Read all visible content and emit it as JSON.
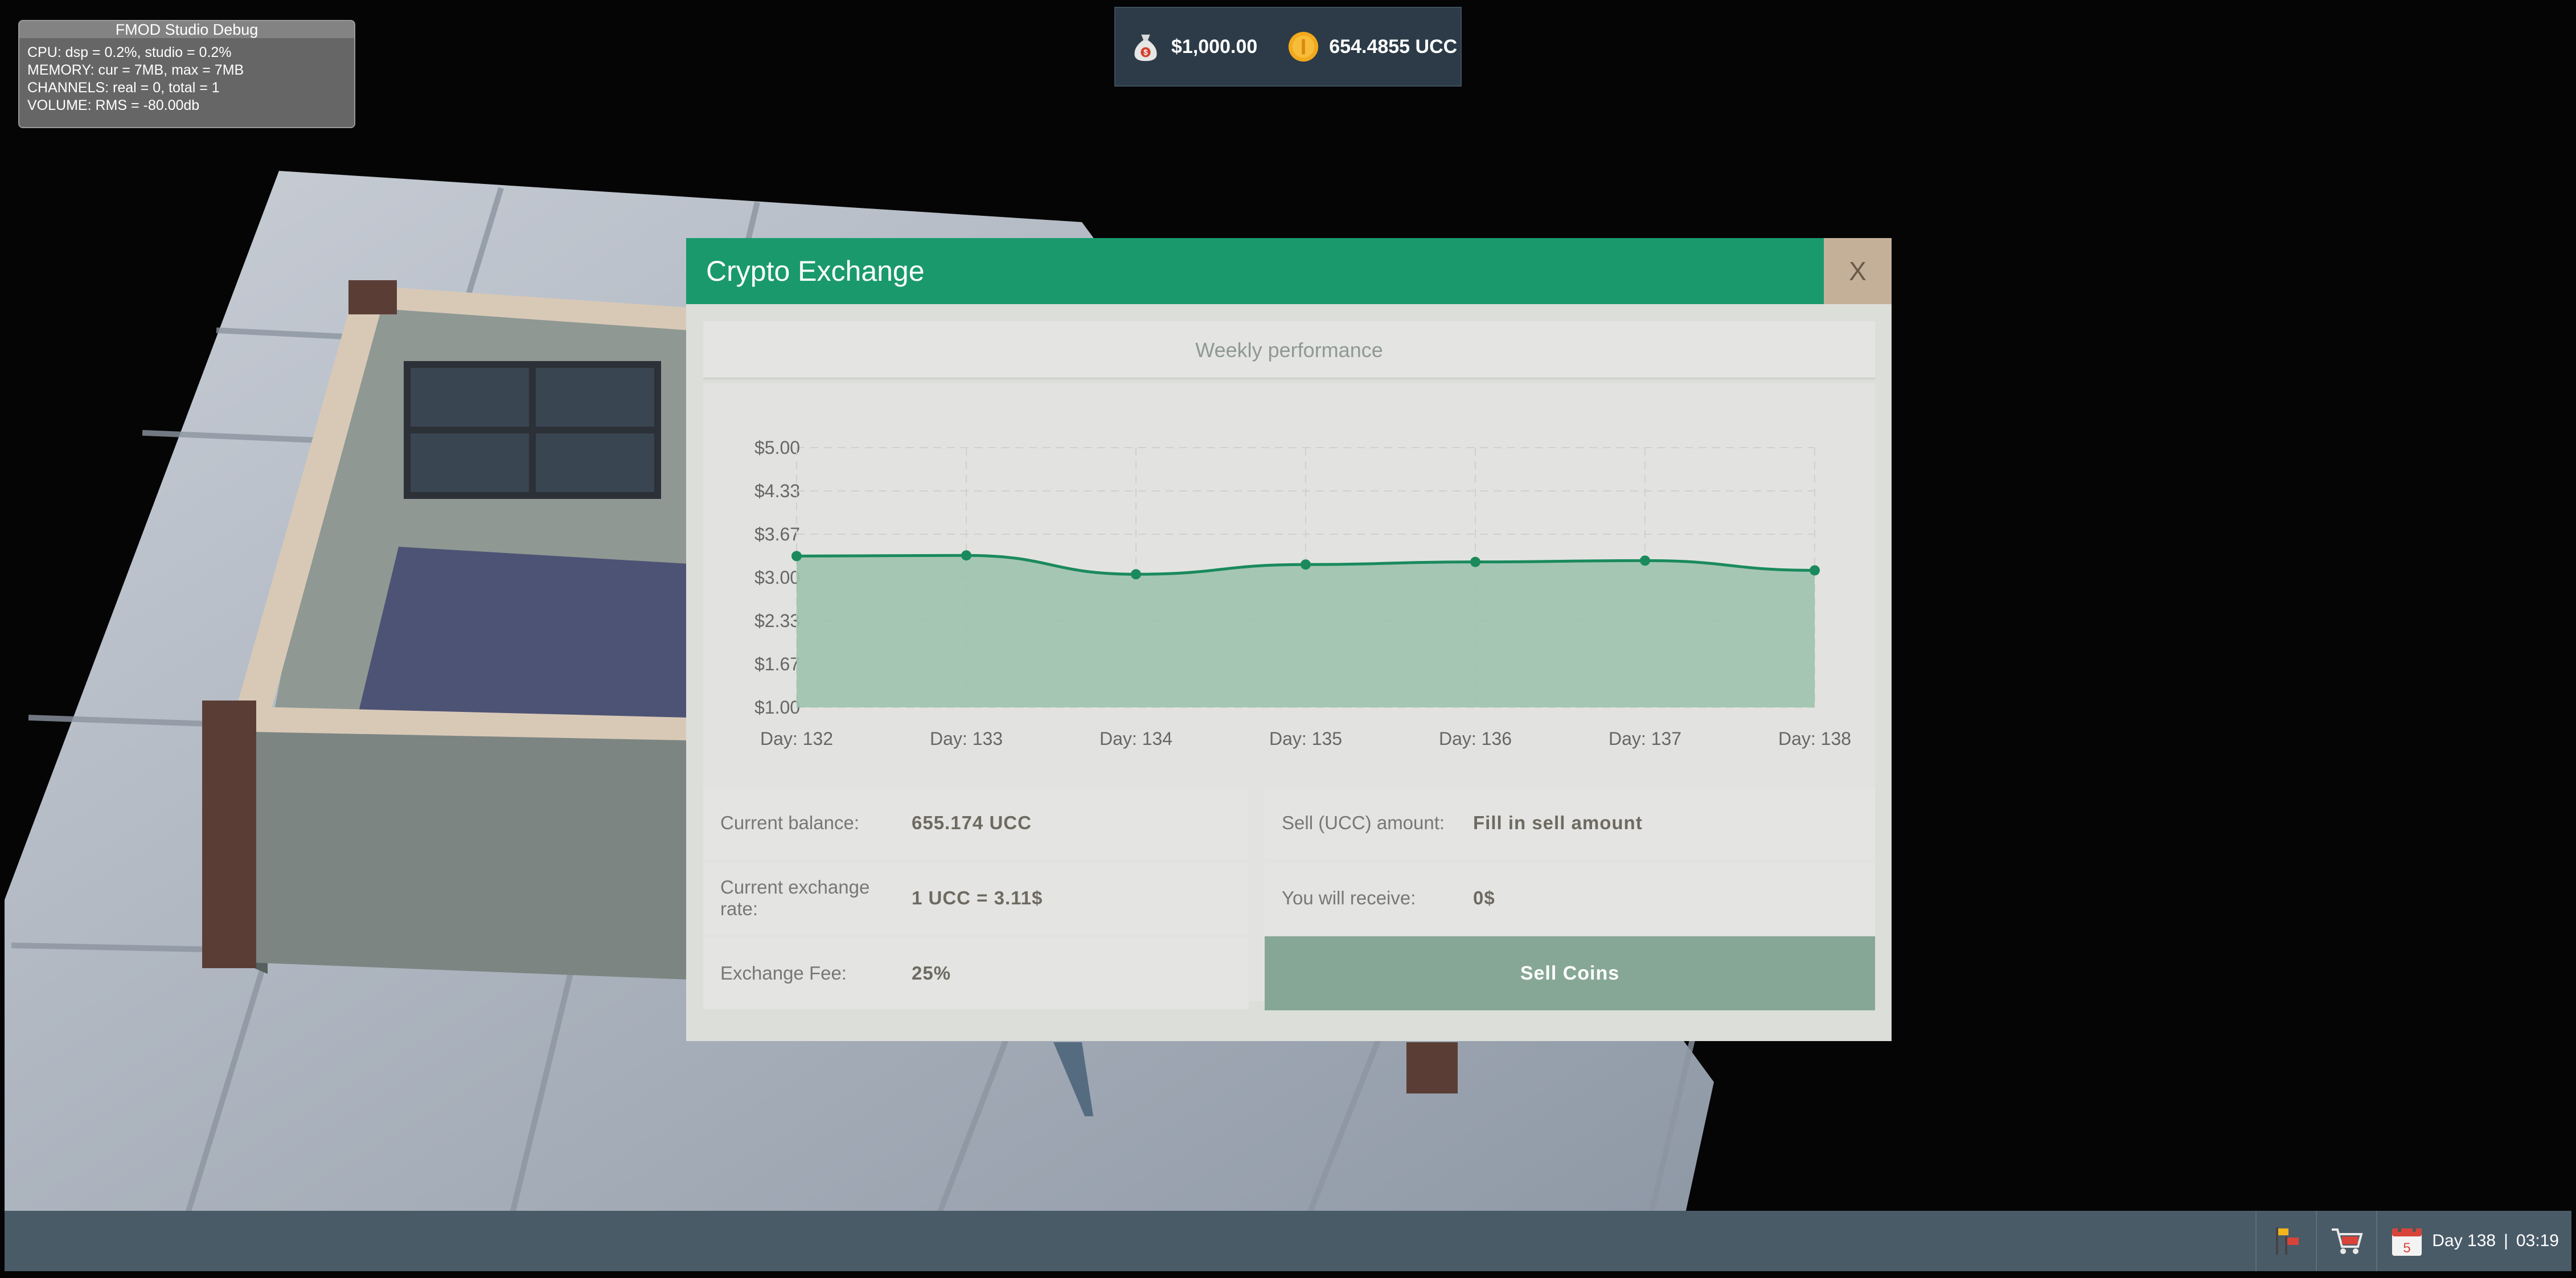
{
  "colors": {
    "accent_green": "#1a9a6c",
    "chart_line": "#1a8a5c",
    "chart_fill": "#9ec2ad",
    "sell_button": "#87a796",
    "close_button": "#c4b099"
  },
  "debug": {
    "title": "FMOD Studio Debug",
    "lines": [
      "CPU: dsp = 0.2%, studio = 0.2%",
      "MEMORY: cur = 7MB, max = 7MB",
      "CHANNELS: real = 0, total = 1",
      "VOLUME: RMS = -80.00db"
    ]
  },
  "topbar": {
    "money_icon": "money-bag-icon",
    "money": "$1,000.00",
    "coin_icon": "coin-icon",
    "coins": "654.4855 UCC"
  },
  "modal": {
    "title": "Crypto Exchange",
    "close_label": "X",
    "chart_title": "Weekly performance",
    "current_balance_label": "Current balance:",
    "current_balance_value": "655.174 UCC",
    "exchange_rate_label": "Current exchange rate:",
    "exchange_rate_value": "1 UCC = 3.11$",
    "fee_label": "Exchange Fee:",
    "fee_value": "25%",
    "sell_amount_label": "Sell (UCC) amount:",
    "sell_amount_placeholder": "Fill in sell amount",
    "receive_label": "You will receive:",
    "receive_value": "0$",
    "sell_button_label": "Sell Coins"
  },
  "chart_data": {
    "type": "area",
    "title": "Weekly performance",
    "categories": [
      "Day: 132",
      "Day: 133",
      "Day: 134",
      "Day: 135",
      "Day: 136",
      "Day: 137",
      "Day: 138"
    ],
    "values": [
      3.33,
      3.34,
      3.05,
      3.2,
      3.24,
      3.26,
      3.11
    ],
    "y_ticks": [
      "$5.00",
      "$4.33",
      "$3.67",
      "$3.00",
      "$2.33",
      "$1.67",
      "$1.00"
    ],
    "ylim": [
      1.0,
      5.0
    ],
    "grid": true,
    "legend": false
  },
  "bottombar": {
    "flags_icon": "flags-icon",
    "shop_icon": "shopping-cart-icon",
    "calendar_icon": "calendar-icon",
    "calendar_number": "5",
    "day_text": "Day 138",
    "separator": "|",
    "time_text": "03:19"
  }
}
